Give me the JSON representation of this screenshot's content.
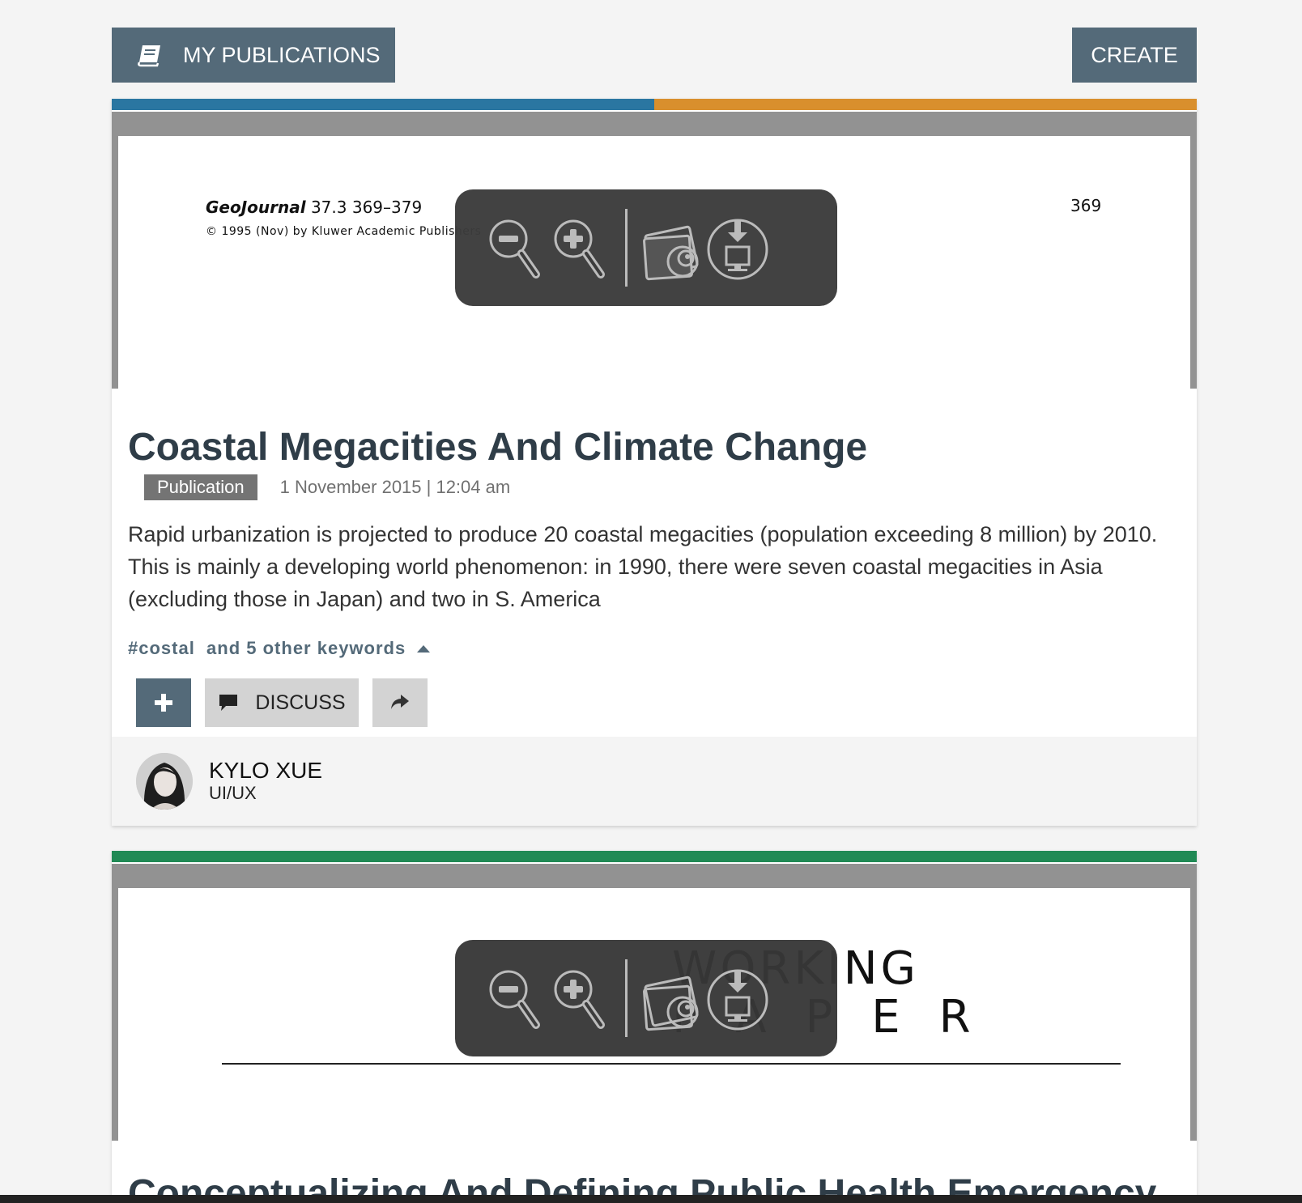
{
  "header": {
    "my_publications_label": "MY PUBLICATIONS",
    "create_label": "CREATE"
  },
  "colors": {
    "nav_button": "#546a79",
    "bar_blue": "#2a76a1",
    "bar_orange": "#d98f2d",
    "bar_green": "#208a55",
    "preview_frame": "#929292"
  },
  "viewer_toolbar": {
    "tools": [
      "zoom-out-icon",
      "zoom-in-icon",
      "gallery-icon",
      "download-icon"
    ]
  },
  "publications": [
    {
      "preview": {
        "journal_name": "GeoJournal",
        "journal_issue": "37.3  369–379",
        "copyright": "© 1995 (Nov) by Kluwer Academic Publishers",
        "page_number": "369"
      },
      "title": "Coastal Megacities And Climate Change",
      "type_badge": "Publication",
      "date": "1 November 2015 | 12:04 am",
      "abstract": "Rapid urbanization is projected to produce 20 coastal megacities (population exceeding 8 million) by 2010. This is mainly a developing world phenomenon: in 1990, there were seven coastal megacities in Asia (excluding those in Japan) and two in S. America",
      "keywords_text": "#costal  and 5 other keywords",
      "discuss_label": "DISCUSS",
      "author": {
        "name": "KYLO XUE",
        "role": "UI/UX"
      }
    },
    {
      "preview": {
        "line1": "WORKING",
        "line2": "PAPER"
      },
      "title": "Conceptualizing And Defining Public Health Emergency"
    }
  ]
}
